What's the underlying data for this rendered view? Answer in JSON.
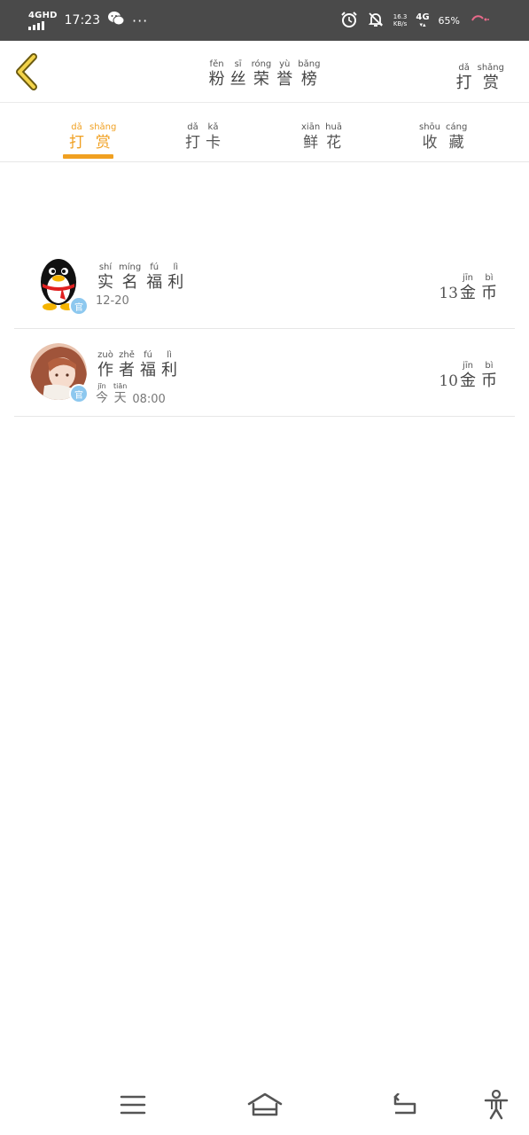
{
  "status_bar": {
    "network_label": "4GHD",
    "time": "17:23",
    "more": "···",
    "speed_value": "16.3",
    "speed_unit": "KB/s",
    "network_type": "4G",
    "battery": "65%"
  },
  "header": {
    "title": [
      {
        "py": "fěn",
        "ch": "粉"
      },
      {
        "py": "sī",
        "ch": "丝"
      },
      {
        "py": "róng",
        "ch": "荣"
      },
      {
        "py": "yù",
        "ch": "誉"
      },
      {
        "py": "bǎng",
        "ch": "榜"
      }
    ],
    "right_link": [
      {
        "py": "dǎ",
        "ch": "打"
      },
      {
        "py": "shǎng",
        "ch": "赏"
      }
    ]
  },
  "tabs": [
    {
      "name": "tab-reward",
      "active": true,
      "chars": [
        {
          "py": "dǎ",
          "ch": "打"
        },
        {
          "py": "shǎng",
          "ch": "赏"
        }
      ]
    },
    {
      "name": "tab-checkin",
      "active": false,
      "chars": [
        {
          "py": "dǎ",
          "ch": "打"
        },
        {
          "py": "kǎ",
          "ch": "卡"
        }
      ]
    },
    {
      "name": "tab-flowers",
      "active": false,
      "chars": [
        {
          "py": "xiān",
          "ch": "鲜"
        },
        {
          "py": "huā",
          "ch": "花"
        }
      ]
    },
    {
      "name": "tab-collect",
      "active": false,
      "chars": [
        {
          "py": "shōu",
          "ch": "收"
        },
        {
          "py": "cáng",
          "ch": "藏"
        }
      ]
    }
  ],
  "rows": [
    {
      "title": [
        {
          "py": "shí",
          "ch": "实"
        },
        {
          "py": "míng",
          "ch": "名"
        },
        {
          "py": "fú",
          "ch": "福"
        },
        {
          "py": "lì",
          "ch": "利"
        }
      ],
      "badge": "官",
      "date_chars": [],
      "date_text": "12-20",
      "amount": "13",
      "unit": [
        {
          "py": "jīn",
          "ch": "金"
        },
        {
          "py": "bì",
          "ch": "币"
        }
      ]
    },
    {
      "title": [
        {
          "py": "zuò",
          "ch": "作"
        },
        {
          "py": "zhě",
          "ch": "者"
        },
        {
          "py": "fú",
          "ch": "福"
        },
        {
          "py": "lì",
          "ch": "利"
        }
      ],
      "badge": "官",
      "date_chars": [
        {
          "py": "jīn",
          "ch": "今"
        },
        {
          "py": "tiān",
          "ch": "天"
        }
      ],
      "date_text": "08:00",
      "amount": "10",
      "unit": [
        {
          "py": "jīn",
          "ch": "金"
        },
        {
          "py": "bì",
          "ch": "币"
        }
      ]
    }
  ],
  "colors": {
    "accent": "#f0a021",
    "status_bar": "#4a4a4a",
    "badge": "#8dc8ef",
    "divider": "#e6e6e6"
  },
  "icons": {
    "back": "chevron-left-icon",
    "menu": "menu-icon",
    "home": "home-icon",
    "return": "back-arrow-icon",
    "accessibility": "accessibility-icon"
  }
}
